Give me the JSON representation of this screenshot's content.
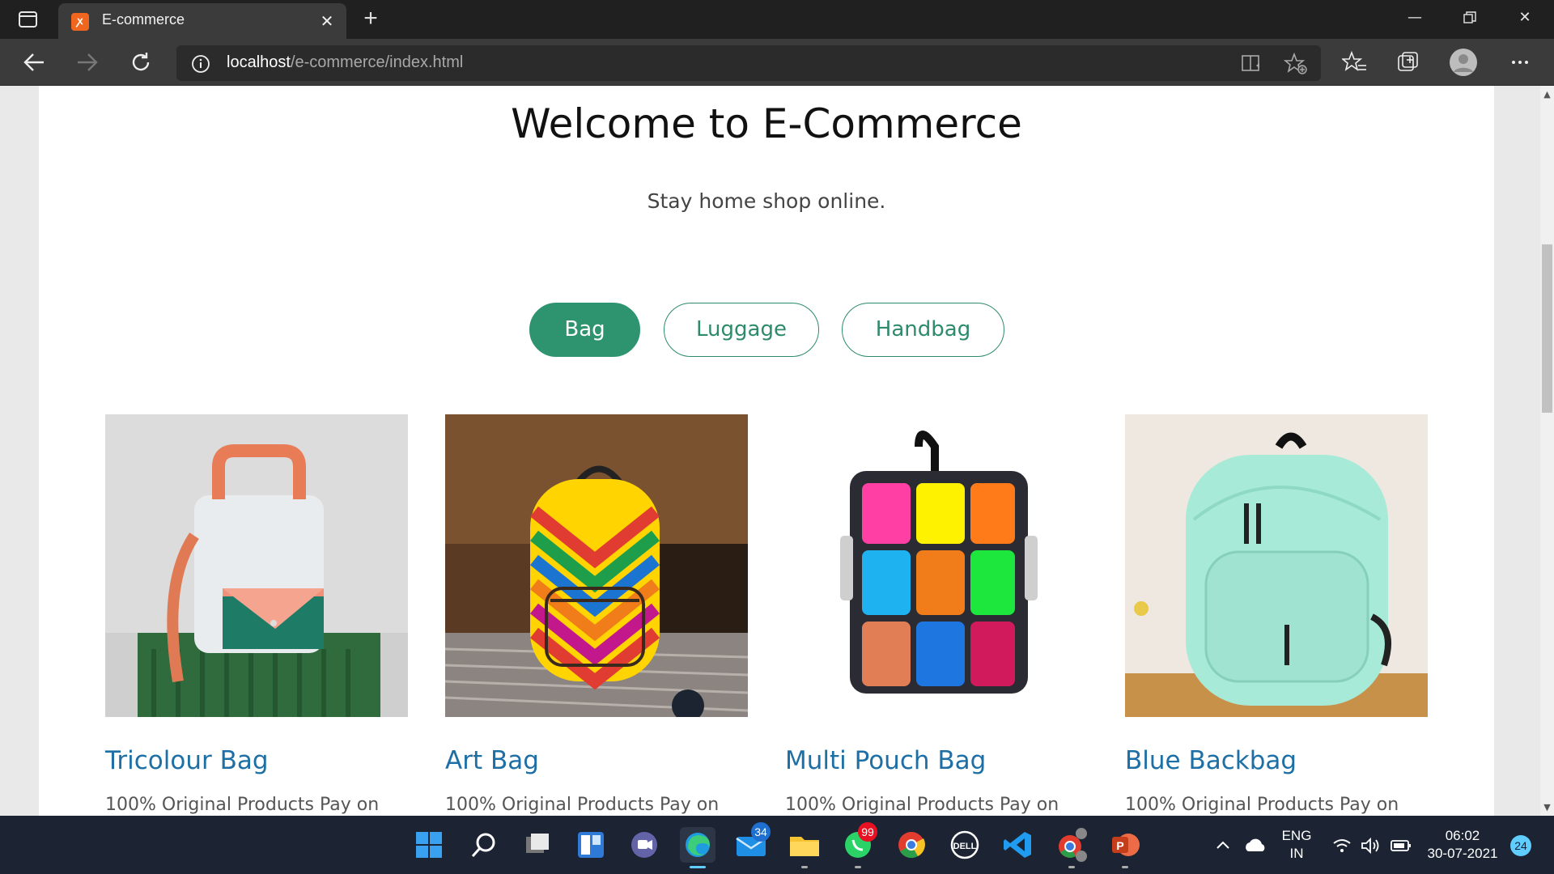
{
  "browser": {
    "tab_title": "E-commerce",
    "url_host": "localhost",
    "url_path": "/e-commerce/index.html"
  },
  "page": {
    "heading": "Welcome to E-Commerce",
    "tagline": "Stay home shop online.",
    "filters": [
      {
        "label": "Bag",
        "active": true
      },
      {
        "label": "Luggage",
        "active": false
      },
      {
        "label": "Handbag",
        "active": false
      }
    ],
    "products": [
      {
        "title": "Tricolour Bag",
        "desc": "100% Original Products Pay on"
      },
      {
        "title": "Art Bag",
        "desc": "100% Original Products Pay on"
      },
      {
        "title": "Multi Pouch Bag",
        "desc": "100% Original Products Pay on"
      },
      {
        "title": "Blue Backbag",
        "desc": "100% Original Products Pay on"
      }
    ]
  },
  "taskbar": {
    "mail_badge": "34",
    "whatsapp_badge": "99",
    "language_line1": "ENG",
    "language_line2": "IN",
    "time": "06:02",
    "date": "30-07-2021",
    "notification_count": "24"
  },
  "colors": {
    "accent": "#2e9470",
    "link": "#1d6fa5"
  }
}
